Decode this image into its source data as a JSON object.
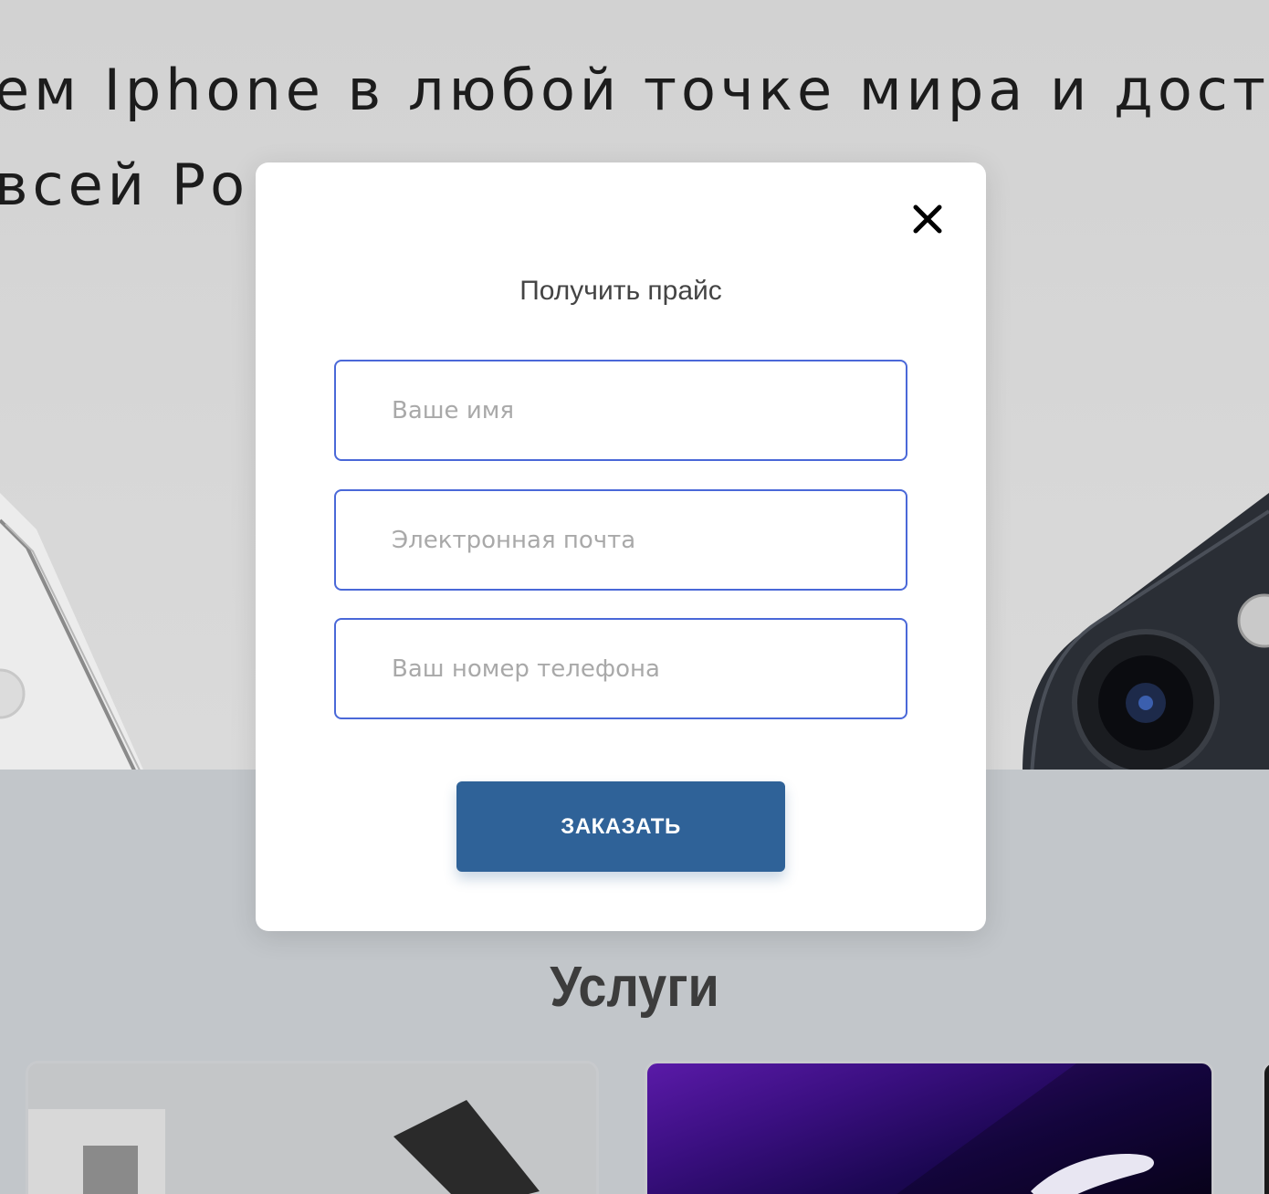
{
  "hero": {
    "line1": "ем Iphone в любой точке мира и доста",
    "line2": "всей Ро                                      ным цена"
  },
  "modal": {
    "title": "Получить прайс",
    "close_icon": "close-icon",
    "fields": {
      "name_placeholder": "Ваше имя",
      "email_placeholder": "Электронная почта",
      "phone_placeholder": "Ваш номер телефона"
    },
    "submit_label": "ЗАКАЗАТЬ"
  },
  "services": {
    "title": "Услуги"
  },
  "colors": {
    "accent_button": "#2f6298",
    "input_border": "#4a68d8",
    "overlay_bg": "#c2c6ca"
  }
}
